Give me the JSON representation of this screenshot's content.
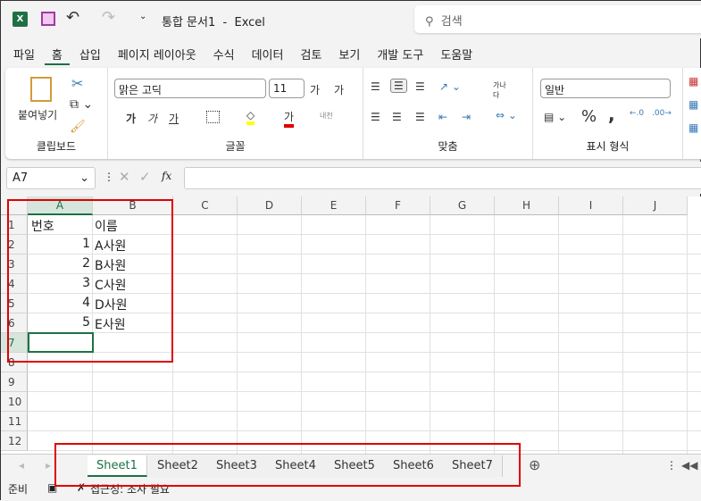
{
  "title": {
    "doc": "통합 문서1",
    "app": "Excel",
    "separator": "-"
  },
  "search": {
    "placeholder": "검색"
  },
  "menu": [
    "파일",
    "홈",
    "삽입",
    "페이지 레이아웃",
    "수식",
    "데이터",
    "검토",
    "보기",
    "개발 도구",
    "도움말"
  ],
  "ribbon": {
    "clipboard": {
      "paste": "붙여넣기",
      "label": "클립보드"
    },
    "font": {
      "name": "맑은 고딕",
      "size": "11",
      "grow": "가",
      "shrink": "가",
      "bold": "가",
      "italic": "가",
      "underline": "가",
      "color": "가",
      "phonetic": "내천",
      "label": "글꼴",
      "fill_color": "#ffff00",
      "font_color": "#e00000"
    },
    "alignment": {
      "label": "맞춤",
      "wrap": "가나다"
    },
    "number": {
      "format": "일반",
      "percent": "%",
      "comma": ",",
      "label": "표시 형식"
    }
  },
  "formula_bar": {
    "name_box": "A7",
    "fx": "fx"
  },
  "columns": [
    "A",
    "B",
    "C",
    "D",
    "E",
    "F",
    "G",
    "H",
    "I",
    "J"
  ],
  "rows": [
    "1",
    "2",
    "3",
    "4",
    "5",
    "6",
    "7",
    "8",
    "9",
    "10",
    "11",
    "12"
  ],
  "cells": [
    {
      "a": "번호",
      "b": "이름"
    },
    {
      "a": "1",
      "b": "A사원"
    },
    {
      "a": "2",
      "b": "B사원"
    },
    {
      "a": "3",
      "b": "C사원"
    },
    {
      "a": "4",
      "b": "D사원"
    },
    {
      "a": "5",
      "b": "E사원"
    }
  ],
  "sheets": [
    "Sheet1",
    "Sheet2",
    "Sheet3",
    "Sheet4",
    "Sheet5",
    "Sheet6",
    "Sheet7"
  ],
  "active_sheet": "Sheet1",
  "status": {
    "ready": "준비",
    "accessibility": "접근성: 조사 필요"
  },
  "colors": {
    "accent": "#1e7145",
    "highlight": "#e00000"
  }
}
